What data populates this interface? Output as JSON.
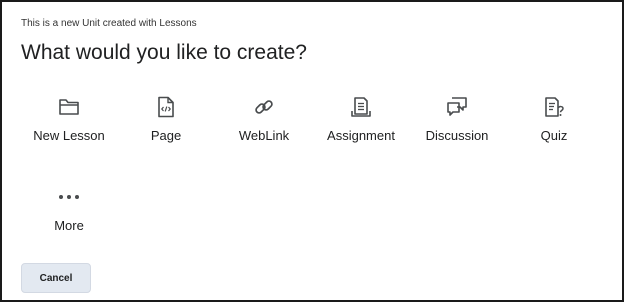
{
  "dialog": {
    "subtitle": "This is a new Unit created with Lessons",
    "title": "What would you like to create?"
  },
  "options": [
    {
      "label": "New Lesson",
      "icon": "folder-icon"
    },
    {
      "label": "Page",
      "icon": "code-file-icon"
    },
    {
      "label": "WebLink",
      "icon": "link-icon"
    },
    {
      "label": "Assignment",
      "icon": "assignment-icon"
    },
    {
      "label": "Discussion",
      "icon": "discussion-icon"
    },
    {
      "label": "Quiz",
      "icon": "quiz-icon"
    },
    {
      "label": "More",
      "icon": "more-dots-icon"
    }
  ],
  "footer": {
    "cancel_label": "Cancel"
  }
}
